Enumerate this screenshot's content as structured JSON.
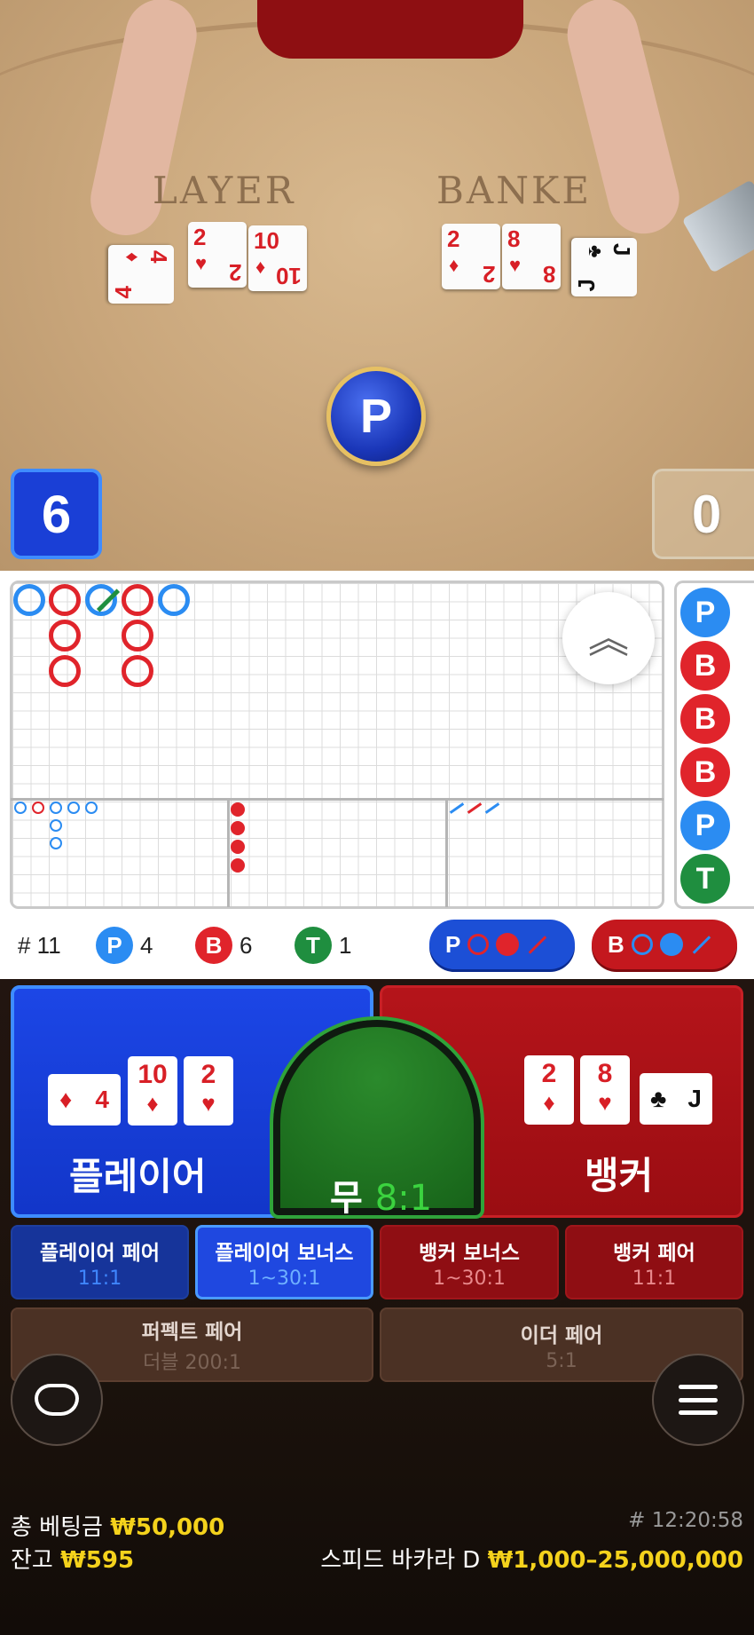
{
  "table": {
    "player_word": "LAYER",
    "banker_word": "BANKE",
    "result_chip": "P",
    "player_score": "6",
    "banker_score": "0",
    "player_cards": [
      {
        "rank": "4",
        "suit": "♦",
        "color": "red"
      },
      {
        "rank": "2",
        "suit": "♥",
        "color": "red"
      },
      {
        "rank": "10",
        "suit": "♦",
        "color": "red"
      }
    ],
    "banker_cards": [
      {
        "rank": "2",
        "suit": "♦",
        "color": "red"
      },
      {
        "rank": "8",
        "suit": "♥",
        "color": "red"
      },
      {
        "rank": "J",
        "suit": "♣",
        "color": "black"
      }
    ]
  },
  "roadmap": {
    "bead_road": [
      "P",
      "B",
      "B",
      "B",
      "P",
      "T"
    ],
    "expand_icon": "chevron-double-up-icon"
  },
  "stats": {
    "round": "# 11",
    "player_label": "P",
    "player_count": "4",
    "banker_label": "B",
    "banker_count": "6",
    "tie_label": "T",
    "tie_count": "1",
    "ask_player": "P",
    "ask_banker": "B"
  },
  "bets": {
    "player": "플레이어",
    "banker": "뱅커",
    "tie": "무",
    "tie_odds": "8:1",
    "player_pair": {
      "title": "플레이어 페어",
      "odds": "11:1"
    },
    "player_bonus": {
      "title": "플레이어 보너스",
      "odds": "1~30:1"
    },
    "banker_bonus": {
      "title": "뱅커 보너스",
      "odds": "1~30:1"
    },
    "banker_pair": {
      "title": "뱅커 페어",
      "odds": "11:1"
    },
    "perfect_pair": {
      "title": "퍼펙트 페어",
      "odds": "더블 200:1"
    },
    "either_pair": {
      "title": "이더 페어",
      "odds": "5:1"
    }
  },
  "footer": {
    "total_bet_label": "총 베팅금",
    "total_bet_value": "₩50,000",
    "balance_label": "잔고",
    "balance_value": "₩595",
    "time": "# 12:20:58",
    "table_name": "스피드 바카라 D",
    "limits": "₩1,000–25,000,000"
  },
  "colors": {
    "player_blue": "#1c46e6",
    "banker_red": "#b5141a",
    "tie_green": "#2b8a2c",
    "gold": "#f4d21c"
  }
}
